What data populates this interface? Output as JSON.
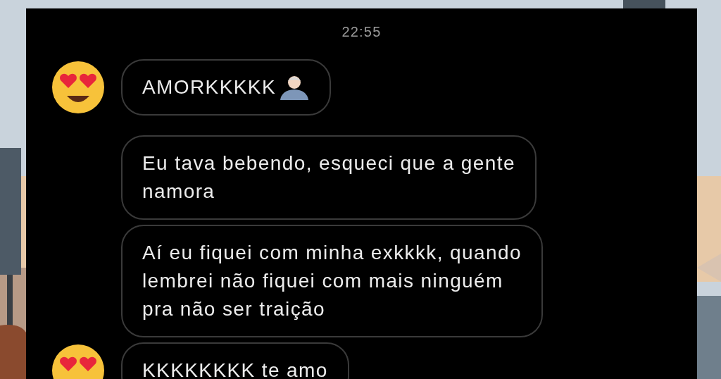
{
  "time": "22:55",
  "messages": [
    {
      "lines": [
        "AMORKKKKK"
      ],
      "avatar": true,
      "trailing_icon": true
    },
    {
      "lines": [
        "Eu tava bebendo, esqueci que a gente",
        "namora"
      ],
      "avatar": false,
      "trailing_icon": false
    },
    {
      "lines": [
        "Aí eu fiquei com minha exkkkk, quando",
        "lembrei não fiquei com mais ninguém",
        "pra não ser traição"
      ],
      "avatar": false,
      "trailing_icon": false
    },
    {
      "lines": [
        "KKKKKKKK te amo"
      ],
      "avatar": true,
      "trailing_icon": false
    }
  ]
}
